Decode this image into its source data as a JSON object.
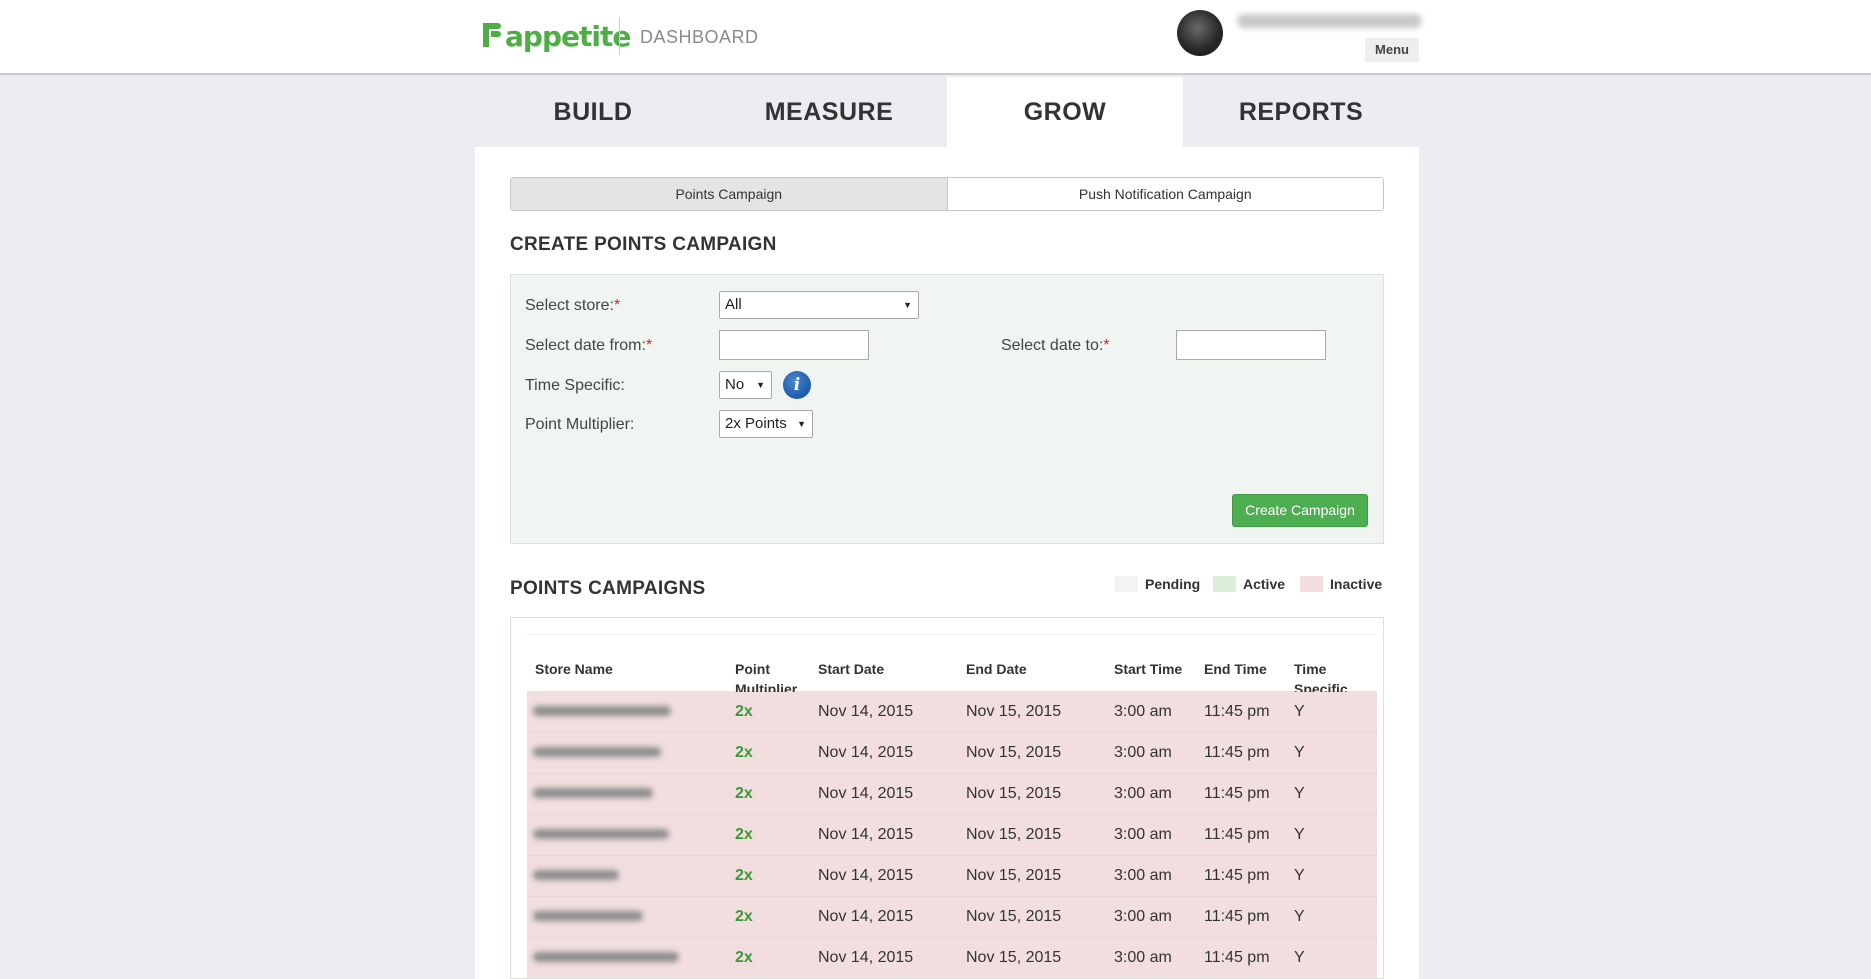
{
  "header": {
    "logo_text_green": "appetite",
    "logo_text_rest": "",
    "section": "DASHBOARD",
    "menu_label": "Menu",
    "icons": {
      "avatar": "user-avatar",
      "logo": "appetite-logo"
    }
  },
  "nav": {
    "tabs": [
      {
        "label": "BUILD",
        "active": false
      },
      {
        "label": "MEASURE",
        "active": false
      },
      {
        "label": "GROW",
        "active": true
      },
      {
        "label": "REPORTS",
        "active": false
      }
    ]
  },
  "subtabs": [
    {
      "label": "Points Campaign",
      "active": true
    },
    {
      "label": "Push Notification Campaign",
      "active": false
    }
  ],
  "create_form": {
    "title": "CREATE POINTS CAMPAIGN",
    "store_label": "Select store:",
    "store_value": "All",
    "date_from_label": "Select date from:",
    "date_from_value": "",
    "date_to_label": "Select date to:",
    "date_to_value": "",
    "time_specific_label": "Time Specific:",
    "time_specific_value": "No",
    "multiplier_label": "Point Multiplier:",
    "multiplier_value": "2x Points",
    "required_mark": "*",
    "info_glyph": "i",
    "submit_label": "Create Campaign"
  },
  "campaigns": {
    "title": "POINTS CAMPAIGNS",
    "legend": [
      {
        "label": "Pending",
        "color": "#f3f3f3"
      },
      {
        "label": "Active",
        "color": "#dcefd8"
      },
      {
        "label": "Inactive",
        "color": "#f2dede"
      }
    ],
    "columns": {
      "store": "Store Name",
      "multiplier_line1": "Point",
      "multiplier_line2": "Multiplier",
      "start_date": "Start Date",
      "end_date": "End Date",
      "start_time": "Start Time",
      "end_time": "End Time",
      "time_specific_line1": "Time",
      "time_specific_line2": "Specific"
    },
    "rows": [
      {
        "multiplier": "2x",
        "start_date": "Nov 14, 2015",
        "end_date": "Nov 15, 2015",
        "start_time": "3:00 am",
        "end_time": "11:45 pm",
        "time_specific": "Y"
      },
      {
        "multiplier": "2x",
        "start_date": "Nov 14, 2015",
        "end_date": "Nov 15, 2015",
        "start_time": "3:00 am",
        "end_time": "11:45 pm",
        "time_specific": "Y"
      },
      {
        "multiplier": "2x",
        "start_date": "Nov 14, 2015",
        "end_date": "Nov 15, 2015",
        "start_time": "3:00 am",
        "end_time": "11:45 pm",
        "time_specific": "Y"
      },
      {
        "multiplier": "2x",
        "start_date": "Nov 14, 2015",
        "end_date": "Nov 15, 2015",
        "start_time": "3:00 am",
        "end_time": "11:45 pm",
        "time_specific": "Y"
      },
      {
        "multiplier": "2x",
        "start_date": "Nov 14, 2015",
        "end_date": "Nov 15, 2015",
        "start_time": "3:00 am",
        "end_time": "11:45 pm",
        "time_specific": "Y"
      },
      {
        "multiplier": "2x",
        "start_date": "Nov 14, 2015",
        "end_date": "Nov 15, 2015",
        "start_time": "3:00 am",
        "end_time": "11:45 pm",
        "time_specific": "Y"
      },
      {
        "multiplier": "2x",
        "start_date": "Nov 14, 2015",
        "end_date": "Nov 15, 2015",
        "start_time": "3:00 am",
        "end_time": "11:45 pm",
        "time_specific": "Y"
      }
    ]
  },
  "colors": {
    "brand_green": "#4cae45",
    "button_green": "#4cae50",
    "inactive_row": "#f2dede",
    "form_bg": "#f1f5f1"
  }
}
